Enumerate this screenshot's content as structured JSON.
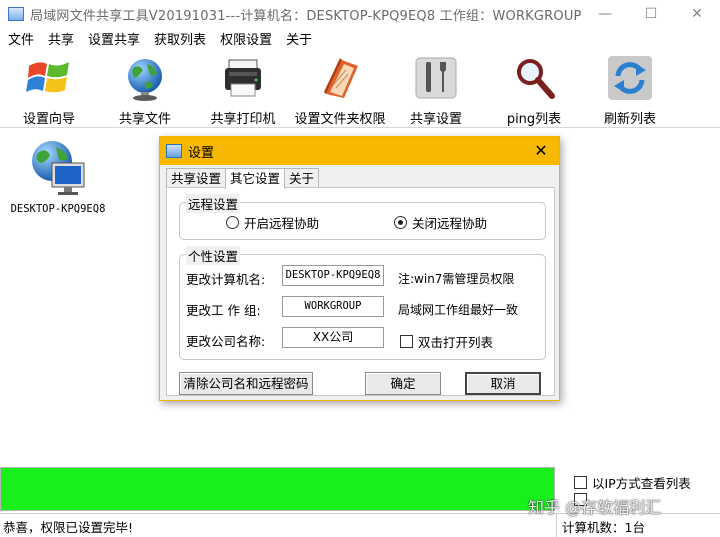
{
  "window": {
    "title": "局域网文件共享工具V20191031---计算机名：DESKTOP-KPQ9EQ8  工作组：WORKGROUP",
    "minimize_icon": "minimize-icon",
    "maximize_icon": "maximize-icon",
    "close_icon": "close-icon"
  },
  "menu": [
    "文件",
    "共享",
    "设置共享",
    "获取列表",
    "权限设置",
    "关于"
  ],
  "toolbar": [
    {
      "label": "设置向导",
      "icon": "windows-logo-icon"
    },
    {
      "label": "共享文件",
      "icon": "globe-icon"
    },
    {
      "label": "共享打印机",
      "icon": "printer-icon"
    },
    {
      "label": "设置文件夹权限",
      "icon": "folder-book-icon"
    },
    {
      "label": "共享设置",
      "icon": "tools-icon"
    },
    {
      "label": "ping列表",
      "icon": "magnifier-icon"
    },
    {
      "label": "刷新列表",
      "icon": "refresh-icon"
    }
  ],
  "computers": [
    {
      "name": "DESKTOP-KPQ9EQ8",
      "icon": "networked-pc-icon"
    }
  ],
  "dialog": {
    "title": "设置",
    "tabs": [
      "共享设置",
      "其它设置",
      "关于"
    ],
    "active_tab": "其它设置",
    "remote_group": {
      "label": "远程设置",
      "options": [
        {
          "label": "开启远程协助",
          "checked": false
        },
        {
          "label": "关闭远程协助",
          "checked": true
        }
      ]
    },
    "personal_group": {
      "label": "个性设置",
      "computer_name_label": "更改计算机名:",
      "computer_name_value": "DESKTOP-KPQ9EQ8",
      "computer_name_note": "注:win7需管理员权限",
      "workgroup_label": "更改工 作 组:",
      "workgroup_value": "WORKGROUP",
      "workgroup_note": "局域网工作组最好一致",
      "company_label": "更改公司名称:",
      "company_value": "XX公司",
      "dblclick_label": "双击打开列表",
      "dblclick_checked": false
    },
    "clear_button": "清除公司名和远程密码",
    "ok_button": "确定",
    "cancel_button": "取消"
  },
  "progress": {
    "value": 1.0,
    "color": "#18f01c"
  },
  "side_options": [
    {
      "label": "以IP方式查看列表",
      "checked": false
    }
  ],
  "status": {
    "message": "恭喜，权限已设置完毕!",
    "count": "计算机数：1台"
  },
  "watermark": "知乎 @存软福利汇"
}
